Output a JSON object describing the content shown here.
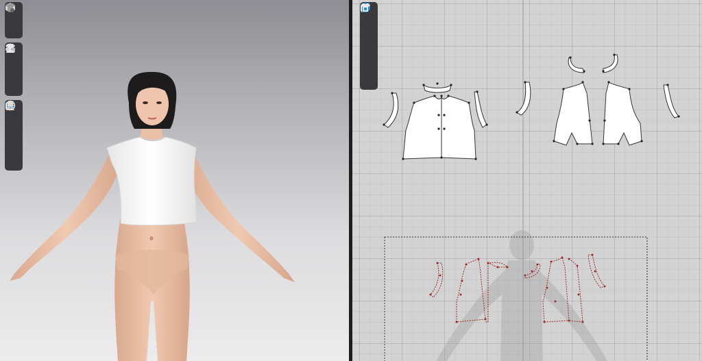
{
  "window_3d": {
    "toolbar_groups": [
      [
        "avatar-box-icon",
        "garment-display-icon"
      ],
      [
        "shirt-icon",
        "sewing-tool-icon",
        "avatar-person-icon"
      ],
      [
        "pattern-fabric-icon",
        "brush-icon",
        "skin-tone-icon",
        "globe-icon"
      ]
    ]
  },
  "window_2d": {
    "toolbar_icons": [
      "pen-tool-icon",
      "shirt-icon",
      "info-icon",
      "pattern-fabric-icon",
      "shirt-print-icon"
    ]
  },
  "colors": {
    "toolbar_bg": "#3a3a3e",
    "icon_light": "#e8e8e8",
    "icon_blue": "#1e90e8",
    "pattern_fill": "#ffffff",
    "pattern_outline": "#333333",
    "sewing_points": "#9c2b2b",
    "grid_bg": "#d3d3d3"
  }
}
